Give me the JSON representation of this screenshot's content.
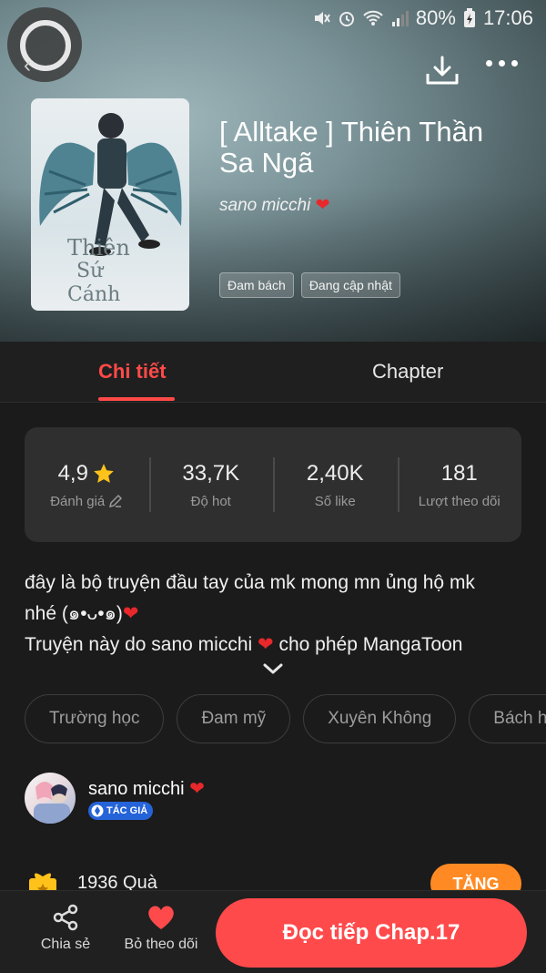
{
  "status_bar": {
    "battery": "80%",
    "time": "17:06"
  },
  "header": {
    "title": "[ Alltake ] Thiên Thần Sa Ngã",
    "author": "sano micchi",
    "tags": [
      "Đam bách",
      "Đang cập nhật"
    ],
    "cover_text": "Thiên"
  },
  "tabs": [
    {
      "label": "Chi tiết",
      "active": true
    },
    {
      "label": "Chapter",
      "active": false
    }
  ],
  "stats": [
    {
      "value": "4,9",
      "label": "Đánh giá"
    },
    {
      "value": "33,7K",
      "label": "Độ hot"
    },
    {
      "value": "2,40K",
      "label": "Số like"
    },
    {
      "value": "181",
      "label": "Lượt theo dõi"
    }
  ],
  "description": {
    "line1": "đây là bộ truyện đầu tay của mk mong mn ủng hộ mk",
    "line2": "nhé (๑•ᴗ•๑)",
    "line3_start": "Truyện này do sano micchi",
    "line3_end": "cho phép MangaToon"
  },
  "genres": [
    "Trường học",
    "Đam mỹ",
    "Xuyên Không",
    "Bách h"
  ],
  "author_section": {
    "name": "sano micchi",
    "badge": "TÁC GIẢ"
  },
  "gift": {
    "count": "1936 Quà",
    "button": "TẶNG"
  },
  "bottom_bar": {
    "share": "Chia sẻ",
    "unfollow": "Bỏ theo dõi",
    "read_button": "Đọc tiếp Chap.17"
  },
  "colors": {
    "accent": "#ff4a48",
    "gift_button": "#ff8a24",
    "heart": "#e8282b",
    "badge": "#2563d8"
  }
}
